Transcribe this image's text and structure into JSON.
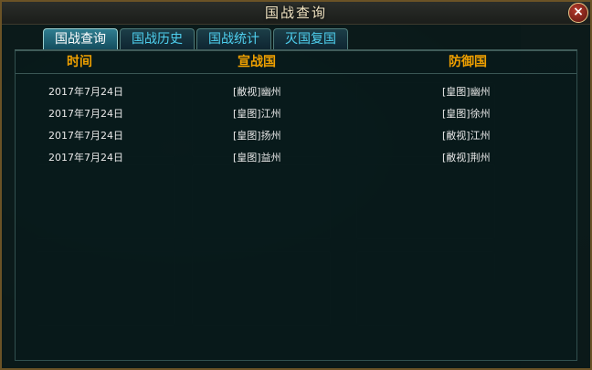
{
  "window": {
    "title": "国战查询",
    "close_label": "×"
  },
  "tabs": [
    {
      "label": "国战查询",
      "active": true
    },
    {
      "label": "国战历史",
      "active": false
    },
    {
      "label": "国战统计",
      "active": false
    },
    {
      "label": "灭国复国",
      "active": false
    }
  ],
  "table": {
    "headers": {
      "time": "时间",
      "attacker": "宣战国",
      "defender": "防御国"
    },
    "rows": [
      {
        "time": "2017年7月24日",
        "attacker": "[敝视]幽州",
        "defender": "[皇图]幽州"
      },
      {
        "time": "2017年7月24日",
        "attacker": "[皇图]江州",
        "defender": "[皇图]徐州"
      },
      {
        "time": "2017年7月24日",
        "attacker": "[皇图]扬州",
        "defender": "[敝视]江州"
      },
      {
        "time": "2017年7月24日",
        "attacker": "[皇图]益州",
        "defender": "[敝视]荆州"
      }
    ]
  },
  "colors": {
    "header_text": "#f0a000",
    "tab_text": "#4fd0ef",
    "active_tab_bg": "#2f7d90",
    "frame": "#6b5326"
  }
}
